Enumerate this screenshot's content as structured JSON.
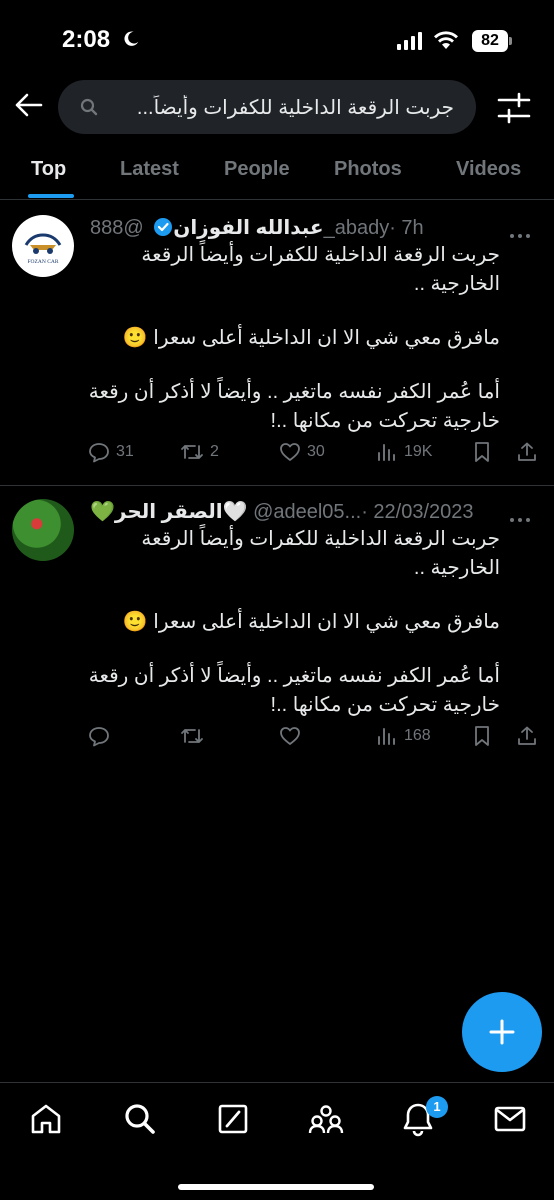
{
  "status_bar": {
    "time": "2:08",
    "battery": "82"
  },
  "search": {
    "query": "جربت الرقعة الداخلية للكفرات وأيضاً..."
  },
  "tabs": [
    {
      "label": "Top"
    },
    {
      "label": "Latest"
    },
    {
      "label": "People"
    },
    {
      "label": "Photos"
    },
    {
      "label": "Videos"
    }
  ],
  "tweets": [
    {
      "display_name": "عبدالله الفوزان",
      "handle": "@888_abady",
      "time": "· 7h",
      "verified": true,
      "avatar_text": "FOZAN CAR",
      "body": [
        "جربت الرقعة الداخلية للكفرات وأيضاً الرقعة الخارجية ..",
        "مافرق معي شي الا ان الداخلية أعلى سعرا 🙂",
        "أما عُمر الكفر نفسه ماتغير .. وأيضاً لا أذكر أن رقعة خارجية تحركت من مكانها ..!"
      ],
      "replies": "31",
      "reposts": "2",
      "likes": "30",
      "views": "19K"
    },
    {
      "display_name": "💚الصقر الحر🤍",
      "handle": "@adeel05...",
      "time": "· 22/03/2023",
      "verified": false,
      "body": [
        "جربت الرقعة الداخلية للكفرات وأيضاً الرقعة الخارجية ..",
        "مافرق معي شي الا ان الداخلية أعلى سعرا 🙂",
        "أما عُمر الكفر نفسه ماتغير .. وأيضاً لا أذكر أن رقعة خارجية تحركت من مكانها ..!"
      ],
      "replies": "",
      "reposts": "",
      "likes": "",
      "views": "168"
    }
  ],
  "bottom_nav": {
    "items": [
      "home-icon",
      "search-icon",
      "grok-icon",
      "communities-icon",
      "notifications-icon",
      "messages-icon"
    ],
    "notification_badge": "1"
  },
  "colors": {
    "accent": "#1d9bf0",
    "background": "#000000",
    "muted": "#71767b",
    "divider": "#2f3336"
  }
}
